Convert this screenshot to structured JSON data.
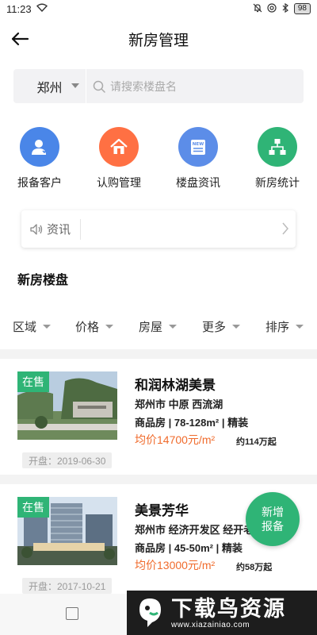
{
  "status_bar": {
    "time": "11:23",
    "battery": "98"
  },
  "header": {
    "title": "新房管理"
  },
  "search": {
    "city": "郑州",
    "placeholder": "请搜索楼盘名"
  },
  "quick_menu": [
    {
      "label": "报备客户",
      "icon": "person-icon",
      "color": "#4a86e8"
    },
    {
      "label": "认购管理",
      "icon": "house-icon",
      "color": "#ff7043"
    },
    {
      "label": "楼盘资讯",
      "icon": "news-icon",
      "color": "#5c8de8"
    },
    {
      "label": "新房统计",
      "icon": "org-chart-icon",
      "color": "#2fb476"
    }
  ],
  "news": {
    "label": "资讯"
  },
  "section": {
    "title": "新房楼盘"
  },
  "filters": [
    "区域",
    "价格",
    "房屋",
    "更多",
    "排序"
  ],
  "listings": [
    {
      "status": "在售",
      "name": "和润林湖美景",
      "location": "郑州市 中原 西流湖",
      "spec": "商品房 | 78-128m² | 精装",
      "price": "均价14700元/m²",
      "total": "约114万起",
      "open_date": "开盘：2019-06-30"
    },
    {
      "status": "在售",
      "name": "美景芳华",
      "location": "郑州市 经济开发区 经开老区",
      "spec": "商品房 | 45-50m² | 精装",
      "price": "均价13000元/m²",
      "total": "约58万起",
      "open_date": "开盘：2017-10-21"
    }
  ],
  "fab": {
    "line1": "新增",
    "line2": "报备"
  },
  "watermark": {
    "title": "下载鸟资源",
    "url": "www.xiazainiao.com"
  },
  "colors": {
    "accent": "#2fb476",
    "price": "#f06b2c"
  }
}
